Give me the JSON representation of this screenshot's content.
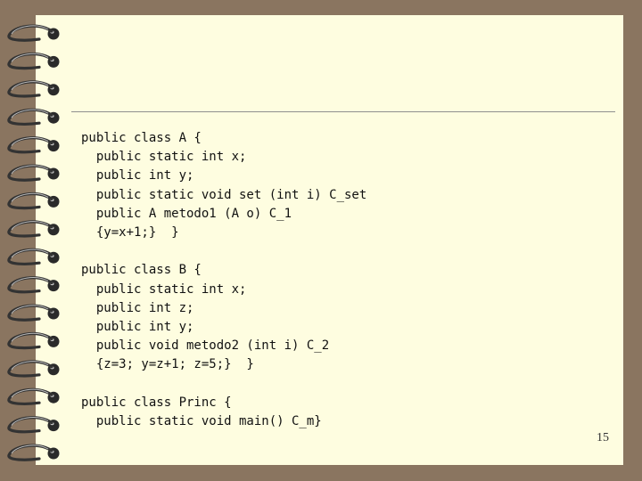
{
  "slide": {
    "title": "",
    "code_blocks": [
      {
        "lines": [
          "public class A {",
          "  public static int x;",
          "  public int y;",
          "  public static void set (int i) C_set",
          "  public A metodo1 (A o) C_1",
          "  {y=x+1;}  }"
        ]
      },
      {
        "lines": [
          "public class B {",
          "  public static int x;",
          "  public int z;",
          "  public int y;",
          "  public void metodo2 (int i) C_2",
          "  {z=3; y=z+1; z=5;}  }"
        ]
      },
      {
        "lines": [
          "public class Princ {",
          "  public static void main() C_m}"
        ]
      }
    ],
    "page_number": "15"
  },
  "decor": {
    "ring_icon": "spiral-binding-ring-icon",
    "ring_count": 16,
    "colors": {
      "background": "#8a7560",
      "page": "#fefde0",
      "ring": "#333333",
      "rule": "#8f8f8f"
    }
  }
}
